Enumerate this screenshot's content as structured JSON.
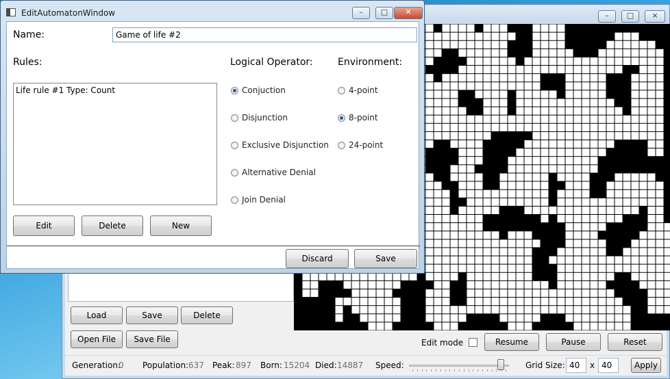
{
  "main_window": {
    "life_grid_colors": {
      "alive": "#000000",
      "dead": "#ffffff"
    },
    "buttons": {
      "load": "Load",
      "save": "Save",
      "delete": "Delete",
      "open_file": "Open File",
      "save_file": "Save File",
      "resume": "Resume",
      "pause": "Pause",
      "reset": "Reset",
      "apply": "Apply"
    },
    "edit_mode_label": "Edit mode",
    "edit_mode_checked": false,
    "status": {
      "generation_label": "Generation:",
      "generation": "0",
      "population_label": "Population:",
      "population": "637",
      "peak_label": "Peak:",
      "peak": "897",
      "born_label": "Born:",
      "born": "15204",
      "died_label": "Died:",
      "died": "14887",
      "speed_label": "Speed:",
      "grid_size_label": "Grid Size:",
      "grid_w": "40",
      "grid_x": "x",
      "grid_h": "40"
    },
    "speed_level": 0.95
  },
  "dialog": {
    "title": "EditAutomatonWindow",
    "name_label": "Name:",
    "name_value": "Game of life #2",
    "rules_label": "Rules:",
    "rules": [
      "Life rule #1  Type: Count"
    ],
    "logical_operator_label": "Logical Operator:",
    "operators": [
      {
        "label": "Conjuction",
        "selected": true
      },
      {
        "label": "Disjunction",
        "selected": false
      },
      {
        "label": "Exclusive Disjunction",
        "selected": false
      },
      {
        "label": "Alternative Denial",
        "selected": false
      },
      {
        "label": "Join Denial",
        "selected": false
      }
    ],
    "environment_label": "Environment:",
    "environments": [
      {
        "label": "4-point",
        "selected": false
      },
      {
        "label": "8-point",
        "selected": true
      },
      {
        "label": "24-point",
        "selected": false
      }
    ],
    "buttons": {
      "edit": "Edit",
      "delete": "Delete",
      "new": "New",
      "discard": "Discard",
      "save": "Save"
    }
  }
}
